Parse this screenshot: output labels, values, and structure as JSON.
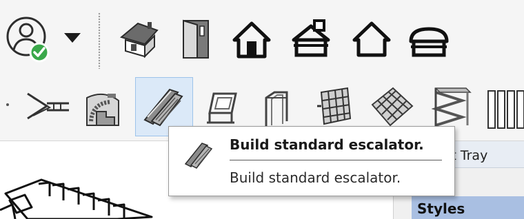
{
  "toolbar_top": {
    "buttons": [
      {
        "name": "user-account-status",
        "icon": "user-check-icon"
      },
      {
        "name": "dropdown-arrow",
        "icon": "triangle-down-icon"
      },
      {
        "name": "house-3d",
        "icon": "house-3d-icon"
      },
      {
        "name": "door",
        "icon": "door-icon"
      },
      {
        "name": "house-outline-solid",
        "icon": "house-solid-icon"
      },
      {
        "name": "roof-building",
        "icon": "roof-building-icon"
      },
      {
        "name": "house-outline",
        "icon": "house-outline-icon"
      },
      {
        "name": "roof-flat",
        "icon": "roof-flat-icon"
      }
    ]
  },
  "toolbar_tools": {
    "buttons": [
      {
        "name": "stair-branch",
        "icon": "stair-branch-icon"
      },
      {
        "name": "stair-spiral",
        "icon": "stair-spiral-icon"
      },
      {
        "name": "escalator",
        "icon": "escalator-icon",
        "selected": true
      },
      {
        "name": "stair-square",
        "icon": "stair-square-icon"
      },
      {
        "name": "ramp-frame",
        "icon": "ramp-frame-icon"
      },
      {
        "name": "railing-grid",
        "icon": "railing-grid-icon"
      },
      {
        "name": "mesh-panel",
        "icon": "mesh-panel-icon"
      },
      {
        "name": "stacked-slabs",
        "icon": "stacked-slabs-icon"
      },
      {
        "name": "panels",
        "icon": "panels-icon"
      }
    ]
  },
  "tooltip": {
    "title": "Build standard escalator.",
    "description": "Build standard escalator.",
    "icon": "escalator-icon"
  },
  "panel": {
    "header": "ult Tray",
    "styles_label": "Styles"
  },
  "colors": {
    "status_green": "#3aa84a",
    "selection_fill": "#dbe9f8",
    "styles_highlight": "#a9bfe2"
  }
}
